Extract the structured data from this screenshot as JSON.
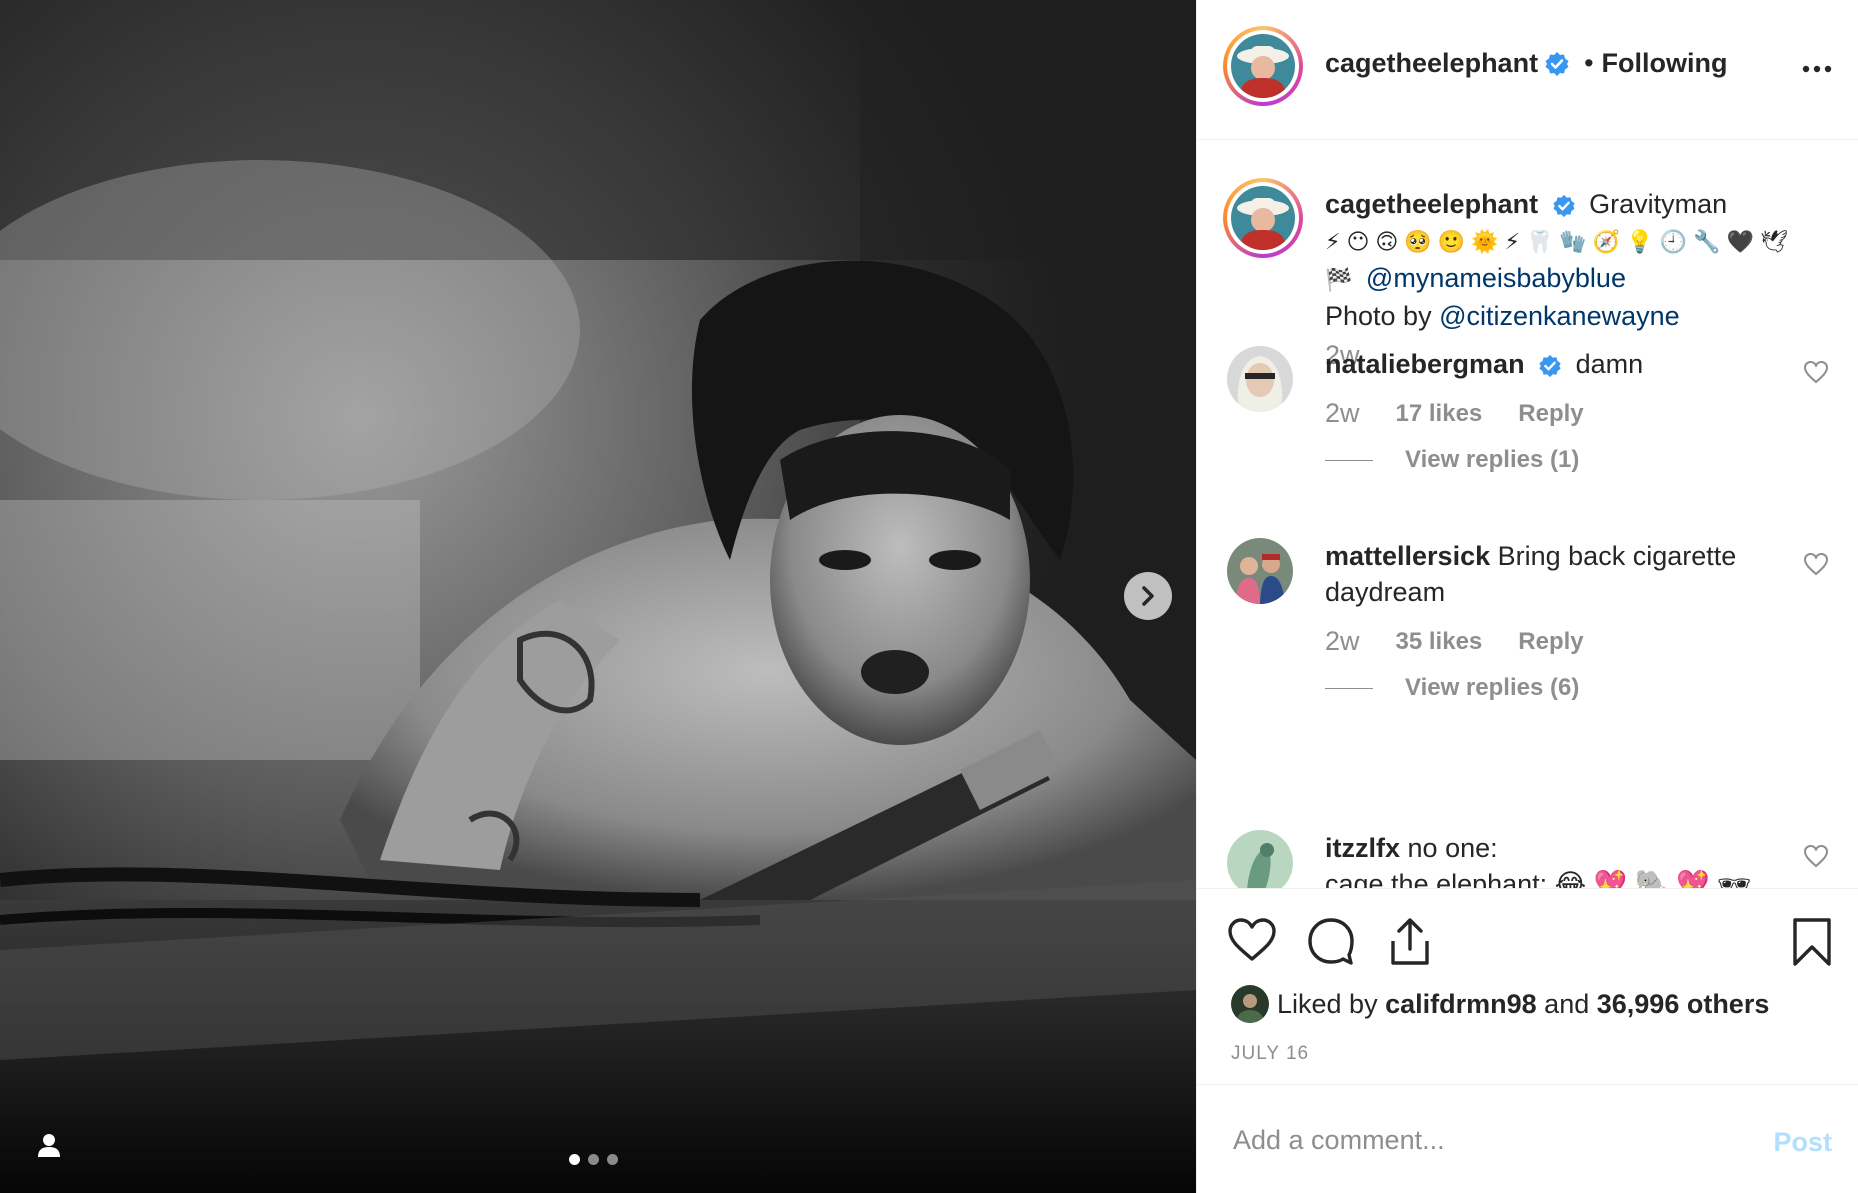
{
  "post": {
    "username": "cagetheelephant",
    "follow_status": "Following",
    "separator": "•",
    "image_count": 3,
    "active_image_index": 0
  },
  "caption": {
    "username": "cagetheelephant",
    "text": "Gravityman",
    "emoji_line": [
      "⚡",
      "😶",
      "🙃",
      "🥺",
      "🙂",
      "🌞",
      "⚡",
      "🦷",
      "🧤",
      "🧭",
      "💡",
      "🕘",
      "🔧",
      "🖤",
      "🕊"
    ],
    "mention_line_emoji": "🏁",
    "mention": "@mynameisbabyblue",
    "photo_by_prefix": "Photo by",
    "photo_by_mention": "@citizenkanewayne",
    "time": "2w"
  },
  "comments": [
    {
      "username": "nataliebergman",
      "verified": true,
      "text": "damn",
      "time": "2w",
      "likes": "17 likes",
      "reply_label": "Reply",
      "view_replies": "View replies (1)"
    },
    {
      "username": "mattellersick",
      "verified": false,
      "text": "Bring back cigarette daydream",
      "time": "2w",
      "likes": "35 likes",
      "reply_label": "Reply",
      "view_replies": "View replies (6)"
    },
    {
      "username": "itzzlfx",
      "verified": false,
      "text": "no one:",
      "text_line2": "cage the elephant: 😂 💖 🐘 💖 🕶"
    }
  ],
  "liked_by": {
    "prefix": "Liked by",
    "user": "califdrmn98",
    "middle": "and",
    "others": "36,996 others"
  },
  "date": "JULY 16",
  "add_comment": {
    "placeholder": "Add a comment...",
    "post_label": "Post"
  },
  "colors": {
    "verified_blue": "#3897f0",
    "link_blue": "#00376b",
    "meta_gray": "#8e8e8e",
    "post_disabled": "#b2dffc"
  },
  "icons": [
    "chevron-right-icon",
    "user-tag-icon",
    "more-icon",
    "verified-icon",
    "heart-icon",
    "comment-icon",
    "share-icon",
    "bookmark-icon"
  ]
}
